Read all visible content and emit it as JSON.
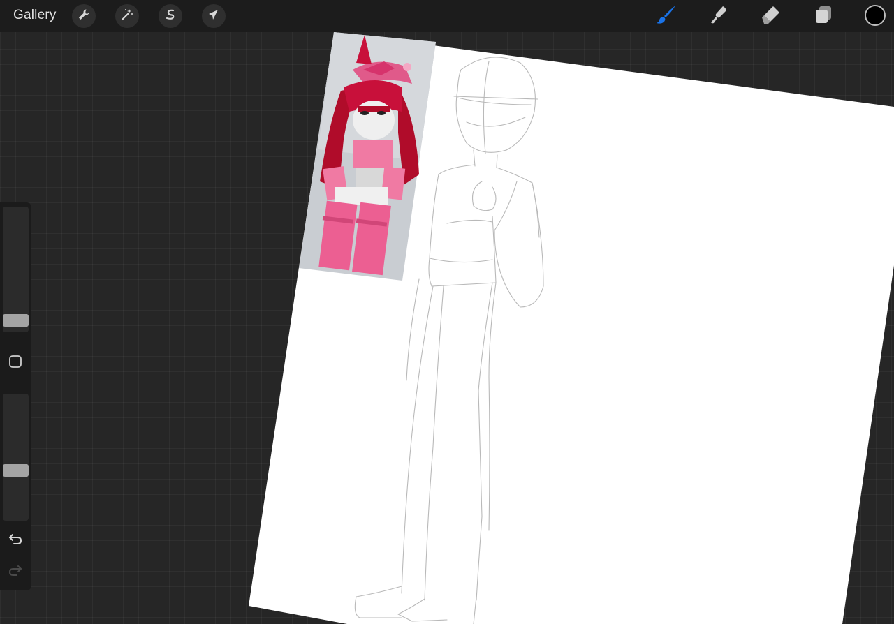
{
  "app": {
    "gallery_label": "Gallery"
  },
  "top_tools": [
    {
      "name": "actions",
      "icon": "wrench-icon"
    },
    {
      "name": "adjustments",
      "icon": "magic-wand-icon"
    },
    {
      "name": "selection",
      "icon": "selection-s-icon"
    },
    {
      "name": "transform",
      "icon": "arrow-cursor-icon"
    }
  ],
  "right_tools": [
    {
      "name": "brush",
      "icon": "brush-icon",
      "active": true
    },
    {
      "name": "smudge",
      "icon": "smudge-icon",
      "active": false
    },
    {
      "name": "eraser",
      "icon": "eraser-icon",
      "active": false
    },
    {
      "name": "layers",
      "icon": "layers-icon",
      "active": false
    }
  ],
  "current_color": "#000000",
  "accent_color": "#1a73e8",
  "sidebar": {
    "brush_size_level": 0.1,
    "opacity_level": 0.4,
    "modify_button_icon": "square-icon",
    "undo_icon": "undo-icon",
    "redo_icon": "redo-icon"
  },
  "reference_image": {
    "description_icon": "reference-photo"
  }
}
